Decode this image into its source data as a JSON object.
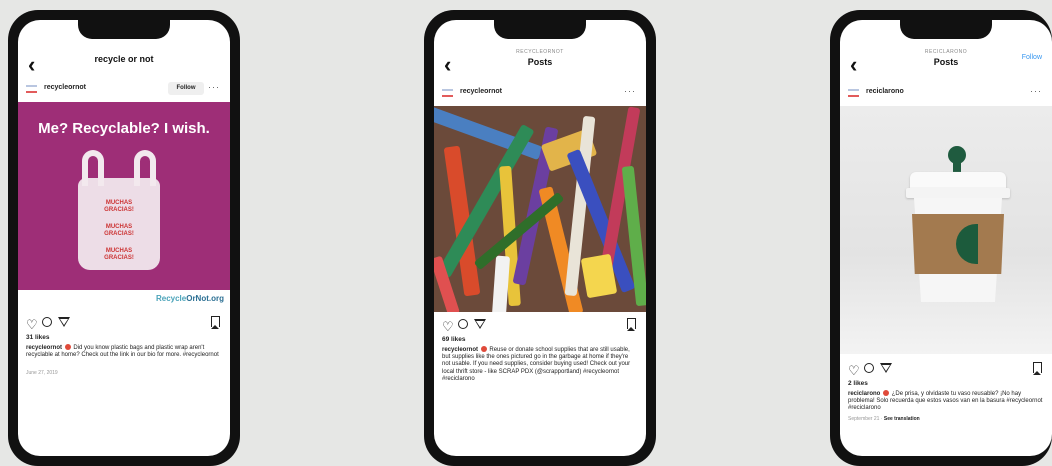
{
  "phones": [
    {
      "header_title": "recycle or not",
      "username": "recycleornot",
      "follow_label": "Follow",
      "more_label": "···",
      "image": {
        "headline": "Me? Recyclable? I wish.",
        "bag_lines": [
          "MUCHAS",
          "GRACIAS!"
        ],
        "brand_prefix": "Recycle",
        "brand_suffix": "OrNot.org"
      },
      "likes": "31 likes",
      "caption_user": "recycleornot",
      "caption_text": "Did you know plastic bags and plastic wrap aren't recyclable at home? Check out the link in our bio for more. #recycleornot",
      "date": "June 27, 2019"
    },
    {
      "header_subtitle": "RECYCLEORNOT",
      "header_title": "Posts",
      "username": "recycleornot",
      "more_label": "···",
      "likes": "69 likes",
      "caption_user": "recycleornot",
      "caption_text": "Reuse or donate school supplies that are still usable, but supplies like the ones pictured go in the garbage at home if they're not usable. If you need supplies, consider buying used! Check out your local thrift store - like SCRAP PDX (@scrapportland) #recycleornot #reciclarono"
    },
    {
      "header_subtitle": "RECICLARONO",
      "header_title": "Posts",
      "follow_label": "Follow",
      "username": "reciclarono",
      "more_label": "···",
      "likes": "2 likes",
      "caption_user": "reciclarono",
      "caption_text": "¿De prisa, y olvidaste tu vaso reusable? ¡No hay problema! Solo recuerda que estos vasos van en la basura #recycleornot #reciclarono",
      "date": "September 21",
      "see_translation": "See translation"
    }
  ]
}
